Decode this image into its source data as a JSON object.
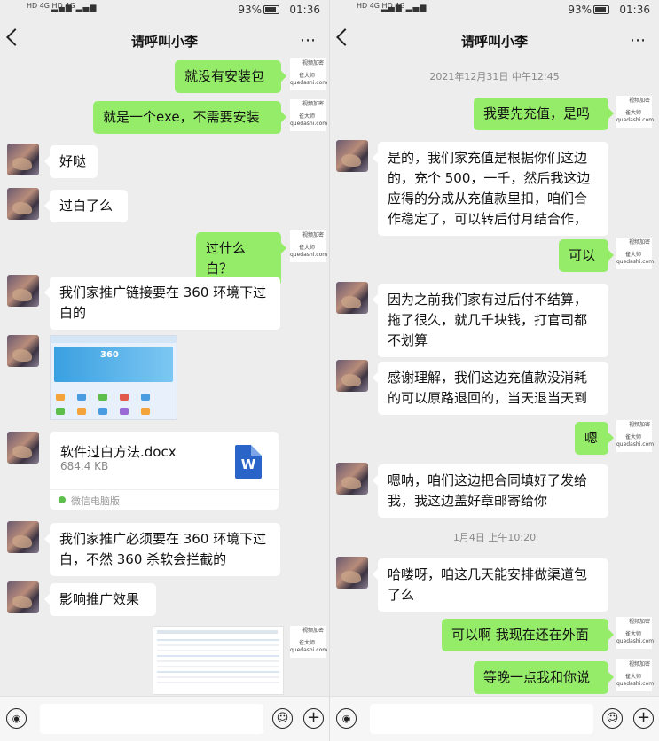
{
  "status": {
    "network": "HD 4G HD 4G",
    "signal": "▂▄▆ ▂▄▆",
    "battery": "93%",
    "time": "01:36"
  },
  "chat_title": "请呼叫小李",
  "more_icon": "⋯",
  "watermark": {
    "line1": "视频加密",
    "line2": "雀大师",
    "line3": "quedashi.com"
  },
  "left": {
    "messages": {
      "m1": "就没有安装包",
      "m2": "就是一个exe，不需要安装",
      "m3": "好哒",
      "m4": "过白了么",
      "m5": "过什么白？",
      "m6": "我们家推广链接要在 360 环境下过白的",
      "m8": "我们家推广必须要在 360 环境下过白，不然 360 杀软会拦截的",
      "m9": "影响推广效果"
    },
    "image_hero_text": "360",
    "file": {
      "name": "软件过白方法.docx",
      "size": "684.4 KB",
      "icon_letter": "W",
      "source": "微信电脑版"
    }
  },
  "right": {
    "timestamp1": "2021年12月31日 中午12:45",
    "timestamp2": "1月4日 上午10:20",
    "messages": {
      "r1": "我要先充值，是吗",
      "r2": "是的，我们家充值是根据你们这边的，充个 500，一千，然后我这边应得的分成从充值款里扣，咱们合作稳定了，可以转后付月结合作，",
      "r3": "可以",
      "r4": "因为之前我们家有过后付不结算，拖了很久，就几千块钱，打官司都不划算",
      "r5": "感谢理解，我们这边充值款没消耗的可以原路退回的，当天退当天到",
      "r6": "嗯",
      "r7": "嗯呐，咱们这边把合同填好了发给我，我这边盖好章邮寄给你",
      "r8": "哈喽呀，咱这几天能安排做渠道包了么",
      "r9": "可以啊 我现在还在外面",
      "r10": "等晚一点我和你说"
    }
  },
  "input": {
    "voice_icon": "◉",
    "emoji_icon": "☺",
    "plus_icon": "+"
  }
}
